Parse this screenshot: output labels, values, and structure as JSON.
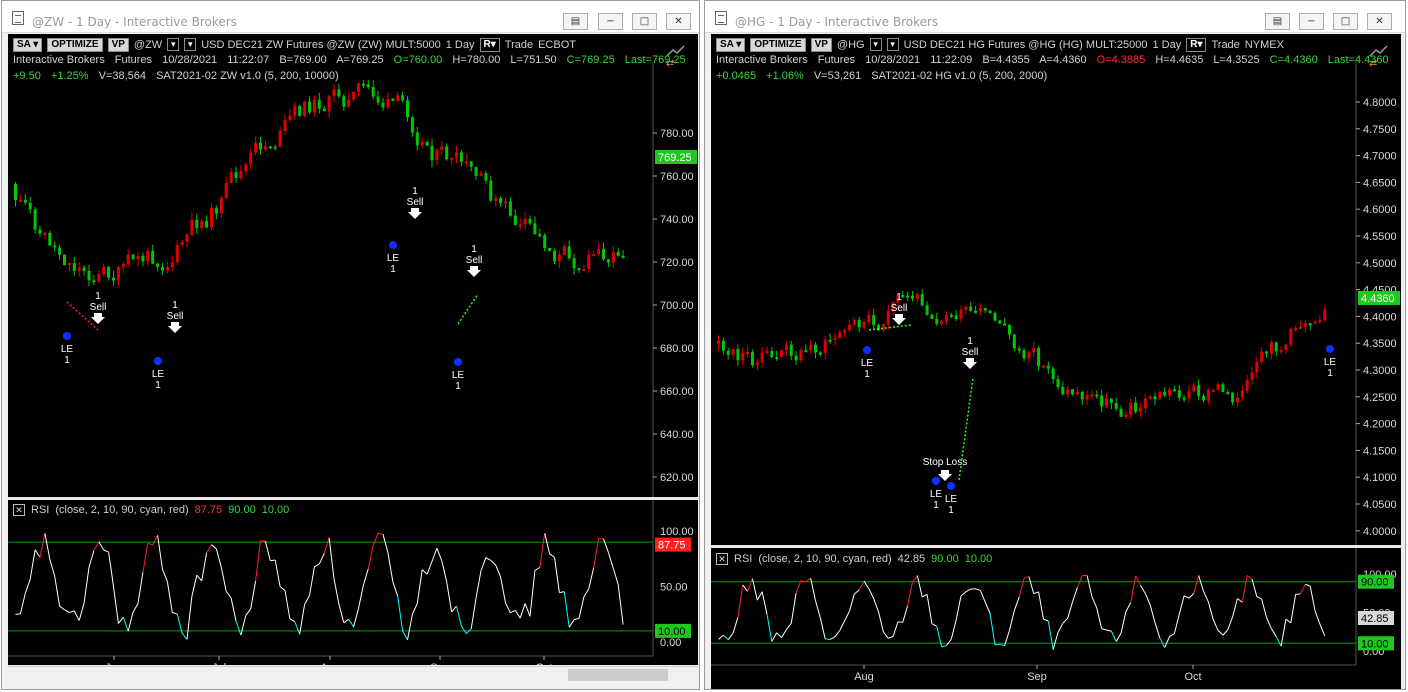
{
  "left": {
    "title": "@ZW - 1 Day - Interactive Brokers",
    "toolbar": {
      "sa": "SA",
      "optimize": "OPTIMIZE",
      "vp": "VP",
      "symbol": "@ZW",
      "description": "USD DEC21 ZW Futures @ZW (ZW) MULT:5000",
      "interval": "1 Day",
      "r": "R",
      "trade": "Trade",
      "exchange": "ECBOT"
    },
    "line2": {
      "broker": "Interactive Brokers",
      "type": "Futures",
      "date": "10/28/2021",
      "time": "11:22:07",
      "bid": "B=769.00",
      "ask": "A=769.25",
      "open": "O=760.00",
      "high": "H=780.00",
      "low": "L=751.50",
      "close": "C=769.25",
      "last": "Last=769.25"
    },
    "line3": {
      "change": "+9.50",
      "pct": "+1.25%",
      "volume": "V=38,564",
      "strategy": "SAT2021-02 ZW v1.0 (5,  200,  10000)"
    },
    "price_axis": [
      "780.00",
      "760.00",
      "740.00",
      "720.00",
      "700.00",
      "680.00",
      "660.00",
      "640.00",
      "620.00"
    ],
    "last_tag": "769.25",
    "months": [
      "Jun",
      "Jul",
      "Aug",
      "Sep",
      "Oct"
    ],
    "rsi": {
      "label": "RSI",
      "params": "(close,  2,  10,  90,  cyan,  red)",
      "value": "87.75",
      "upper": "90.00",
      "lower": "10.00",
      "axis": [
        "100.00",
        "50.00",
        "0.00"
      ],
      "tag_value": "87.75",
      "tag_lower": "10.00"
    },
    "markers": {
      "sell": "Sell",
      "le": "LE",
      "one": "1"
    }
  },
  "right": {
    "title": "@HG - 1 Day - Interactive Brokers",
    "toolbar": {
      "sa": "SA",
      "optimize": "OPTIMIZE",
      "vp": "VP",
      "symbol": "@HG",
      "description": "USD DEC21 HG Futures @HG (HG) MULT:25000",
      "interval": "1 Day",
      "r": "R",
      "trade": "Trade",
      "exchange": "NYMEX"
    },
    "line2": {
      "broker": "Interactive Brokers",
      "type": "Futures",
      "date": "10/28/2021",
      "time": "11:22:09",
      "bid": "B=4.4355",
      "ask": "A=4.4360",
      "open": "O=4.3885",
      "high": "H=4.4635",
      "low": "L=4.3525",
      "close": "C=4.4360",
      "last": "Last=4.4360"
    },
    "line3": {
      "change": "+0.0465",
      "pct": "+1.06%",
      "volume": "V=53,261",
      "strategy": "SAT2021-02 HG v1.0 (5,  200,  2000)"
    },
    "price_axis": [
      "4.8000",
      "4.7500",
      "4.7000",
      "4.6500",
      "4.6000",
      "4.5500",
      "4.5000",
      "4.4500",
      "4.4000",
      "4.3500",
      "4.3000",
      "4.2500",
      "4.2000",
      "4.1500",
      "4.1000",
      "4.0500",
      "4.0000"
    ],
    "last_tag": "4.4360",
    "months": [
      "Aug",
      "Sep",
      "Oct"
    ],
    "rsi": {
      "label": "RSI",
      "params": "(close,  2,  10,  90,  cyan,  red)",
      "value": "42.85",
      "upper": "90.00",
      "lower": "10.00",
      "axis": [
        "100.00",
        "50.00",
        "0.00"
      ],
      "tag_upper": "90.00",
      "tag_value": "42.85",
      "tag_lower": "10.00"
    },
    "markers": {
      "sell": "Sell",
      "le": "LE",
      "one": "1",
      "stop": "Stop Loss"
    }
  },
  "colors": {
    "up": "#00c800",
    "down": "#e00000",
    "rsi_line": "#ffffff",
    "rsi_up": "#00ffff",
    "rsi_down": "#ff2020",
    "band": "#00a000",
    "divider": "#e8e8e8"
  }
}
